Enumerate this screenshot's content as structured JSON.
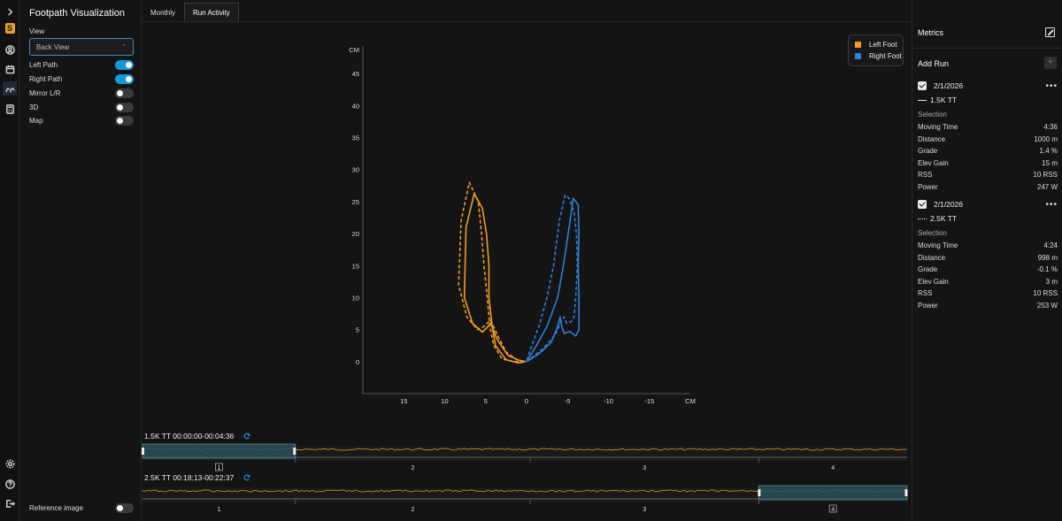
{
  "app_title": "Footpath Visualization",
  "left_panel": {
    "view_label": "View",
    "view_select": {
      "value": "Back View",
      "options": [
        "Back View"
      ]
    },
    "toggles": [
      {
        "label": "Left Path",
        "on": true
      },
      {
        "label": "Right Path",
        "on": true
      },
      {
        "label": "Mirror L/R",
        "on": false
      },
      {
        "label": "3D",
        "on": false
      },
      {
        "label": "Map",
        "on": false
      }
    ],
    "reference_image": {
      "label": "Reference image",
      "on": false
    }
  },
  "tabs": [
    {
      "label": "Monthly",
      "selected": false
    },
    {
      "label": "Run Activity",
      "selected": true
    }
  ],
  "legend": [
    {
      "label": "Left Foot",
      "color": "#f09a2a"
    },
    {
      "label": "Right Foot",
      "color": "#2f7fd8"
    }
  ],
  "chart_data": {
    "type": "line",
    "xlabel": "CM",
    "ylabel": "CM",
    "xlim": [
      20,
      -20
    ],
    "ylim": [
      -5,
      50
    ],
    "x_ticks": [
      15,
      10,
      5,
      0,
      -5,
      -10,
      -15
    ],
    "y_ticks": [
      0,
      5,
      10,
      15,
      20,
      25,
      30,
      35,
      40,
      45
    ],
    "series": [
      {
        "name": "Left Foot",
        "run": "1.5K TT",
        "style": "solid",
        "color": "#f09a2a",
        "x": [
          0.2,
          1,
          2.5,
          3.8,
          4.2,
          4.6,
          4.6,
          4.9,
          5.4,
          6.4,
          7.4,
          7.6,
          6.6,
          5.4,
          4.7,
          4.4,
          3.6,
          2.3,
          0.9,
          0.1
        ],
        "y": [
          0,
          -0.2,
          0.3,
          2.5,
          5.5,
          10,
          15,
          20,
          24,
          26.2,
          21,
          10,
          6,
          4.6,
          5.5,
          6,
          3.5,
          1,
          0.2,
          0
        ]
      },
      {
        "name": "Left Foot",
        "run": "2.5K TT",
        "style": "dashed",
        "color": "#f09a2a",
        "x": [
          0.3,
          1.5,
          3,
          4,
          4.5,
          4.8,
          5.2,
          5.5,
          5.9,
          7,
          8,
          8.3,
          7.3,
          6,
          5.2,
          4.4,
          3.5,
          2.5,
          1.2,
          0.2
        ],
        "y": [
          0,
          0,
          0.4,
          2.5,
          5.5,
          10,
          15,
          20,
          25,
          28,
          22,
          12,
          7,
          5,
          5.5,
          6.5,
          4,
          1.5,
          0.3,
          0
        ]
      },
      {
        "name": "Right Foot",
        "run": "1.5K TT",
        "style": "solid",
        "color": "#2f7fd8",
        "x": [
          0,
          -1.5,
          -3,
          -3.8,
          -4.1,
          -4.3,
          -4.6,
          -5.3,
          -6,
          -6.4,
          -6.4,
          -6.3,
          -6.4,
          -6.3,
          -5.7,
          -5.2,
          -4.5,
          -3.8,
          -2.5,
          -1.2,
          0
        ],
        "y": [
          0,
          1.2,
          3,
          5.5,
          7,
          5.5,
          4.4,
          4.7,
          4,
          5,
          10,
          15,
          20,
          24.5,
          25.5,
          21,
          15,
          10,
          5.5,
          2.5,
          0
        ]
      },
      {
        "name": "Right Foot",
        "run": "2.5K TT",
        "style": "dashed",
        "color": "#2f7fd8",
        "x": [
          0,
          -2,
          -3.5,
          -4.3,
          -4.6,
          -4.9,
          -5.4,
          -5.8,
          -6,
          -6.2,
          -6.1,
          -5.8,
          -5.2,
          -4.7,
          -4,
          -3.3,
          -2.5,
          -1.5,
          -0.5,
          0
        ],
        "y": [
          0,
          2,
          4.2,
          6.5,
          7,
          6,
          6.2,
          7,
          10,
          15,
          20,
          23.5,
          25.5,
          26,
          22,
          15,
          10,
          5.5,
          2,
          0
        ]
      }
    ]
  },
  "tracks": [
    {
      "title": "1.5K TT 00:00:00-00:04:36",
      "labels": [
        "1",
        "2",
        "3",
        "4"
      ],
      "boxed_label": 0,
      "selection": [
        0,
        0.2
      ]
    },
    {
      "title": "2.5K TT 00:18:13-00:22:37",
      "labels": [
        "1",
        "2",
        "3",
        "4"
      ],
      "boxed_label": 3,
      "selection": [
        0.806,
        1.0
      ]
    }
  ],
  "metrics": {
    "title": "Metrics",
    "add_run_label": "Add Run",
    "runs": [
      {
        "date": "2/1/2026",
        "name": "1.5K TT",
        "line_style": "solid",
        "selection_label": "Selection",
        "rows": [
          {
            "label": "Moving Time",
            "value": "4:36"
          },
          {
            "label": "Distance",
            "value": "1000 m"
          },
          {
            "label": "Grade",
            "value": "1.4 %"
          },
          {
            "label": "Elev Gain",
            "value": "15 m"
          },
          {
            "label": "RSS",
            "value": "10 RSS"
          },
          {
            "label": "Power",
            "value": "247 W"
          }
        ]
      },
      {
        "date": "2/1/2026",
        "name": "2.5K TT",
        "line_style": "dotted",
        "selection_label": "Selection",
        "rows": [
          {
            "label": "Moving Time",
            "value": "4:24"
          },
          {
            "label": "Distance",
            "value": "998 m"
          },
          {
            "label": "Grade",
            "value": "-0.1 %"
          },
          {
            "label": "Elev Gain",
            "value": "3 m"
          },
          {
            "label": "RSS",
            "value": "10 RSS"
          },
          {
            "label": "Power",
            "value": "253 W"
          }
        ]
      }
    ]
  },
  "icons": [
    "chevron-right-icon",
    "app-logo-icon",
    "user-circle-icon",
    "calendar-icon",
    "footpath-icon",
    "calculator-icon",
    "settings-icon",
    "help-icon",
    "logout-icon",
    "refresh-icon",
    "expand-icon",
    "plus-icon",
    "more-icon",
    "checkbox-icon"
  ]
}
